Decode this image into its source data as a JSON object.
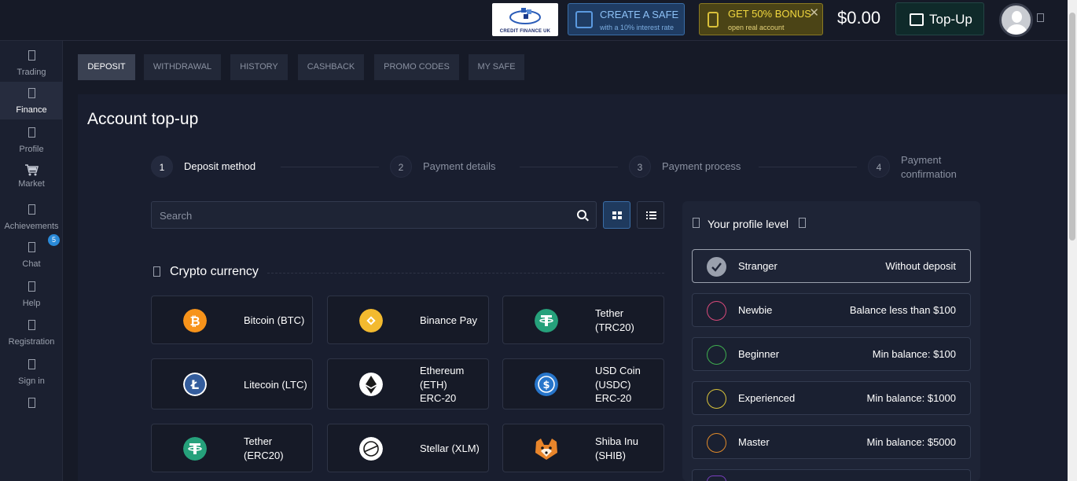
{
  "header": {
    "logo_text": "CREDIT FINANCE UK",
    "safe_title": "CREATE A SAFE",
    "safe_subtitle": "with a 10% interest rate",
    "bonus_title": "GET 50% BONUS",
    "bonus_subtitle": "open real account",
    "bonus_close": "✕",
    "balance": "$0.00",
    "topup_label": "Top-Up"
  },
  "sidebar": {
    "items": [
      {
        "label": "Trading"
      },
      {
        "label": "Finance"
      },
      {
        "label": "Profile"
      },
      {
        "label": "Market"
      },
      {
        "label": "Achievements"
      },
      {
        "label": "Chat"
      },
      {
        "label": "Help"
      },
      {
        "label": "Registration"
      },
      {
        "label": "Sign in"
      }
    ],
    "chat_badge": "5"
  },
  "tabs": [
    {
      "label": "DEPOSIT"
    },
    {
      "label": "WITHDRAWAL"
    },
    {
      "label": "HISTORY"
    },
    {
      "label": "CASHBACK"
    },
    {
      "label": "PROMO CODES"
    },
    {
      "label": "MY SAFE"
    }
  ],
  "page": {
    "title": "Account top-up",
    "steps": [
      {
        "num": "1",
        "label": "Deposit method"
      },
      {
        "num": "2",
        "label": "Payment details"
      },
      {
        "num": "3",
        "label": "Payment process"
      },
      {
        "num": "4",
        "label": "Payment",
        "label2": "confirmation"
      }
    ],
    "search_placeholder": "Search",
    "section_title": "Crypto currency",
    "methods": [
      {
        "label": "Bitcoin (BTC)",
        "icon": "bitcoin-icon",
        "color": "#f7931a"
      },
      {
        "label": "Binance Pay",
        "icon": "binance-icon",
        "color": "#f3ba2f"
      },
      {
        "label": "Tether",
        "label2": "(TRC20)",
        "icon": "tether-icon",
        "color": "#26a17b"
      },
      {
        "label": "Litecoin (LTC)",
        "icon": "litecoin-icon",
        "color": "#345d9d"
      },
      {
        "label": "Ethereum",
        "label2": "(ETH)",
        "label3": "ERC-20",
        "icon": "ethereum-icon",
        "color": "#ffffff"
      },
      {
        "label": "USD Coin",
        "label2": "(USDC)",
        "label3": "ERC-20",
        "icon": "usdc-icon",
        "color": "#2775ca"
      },
      {
        "label": "Tether",
        "label2": "(ERC20)",
        "icon": "tether-icon",
        "color": "#26a17b"
      },
      {
        "label": "Stellar (XLM)",
        "icon": "stellar-icon",
        "color": "#ffffff"
      },
      {
        "label": "Shiba Inu",
        "label2": "(SHIB)",
        "icon": "shiba-icon",
        "color": "#e8852b"
      }
    ]
  },
  "profile_level": {
    "title": "Your profile level",
    "levels": [
      {
        "name": "Stranger",
        "requirement": "Without deposit",
        "color": "#9aa0ad"
      },
      {
        "name": "Newbie",
        "requirement": "Balance less than $100",
        "color": "#d94a7a"
      },
      {
        "name": "Beginner",
        "requirement": "Min balance: $100",
        "color": "#3fae4f"
      },
      {
        "name": "Experienced",
        "requirement": "Min balance: $1000",
        "color": "#d8c23a"
      },
      {
        "name": "Master",
        "requirement": "Min balance: $5000",
        "color": "#e08a2a"
      }
    ]
  }
}
